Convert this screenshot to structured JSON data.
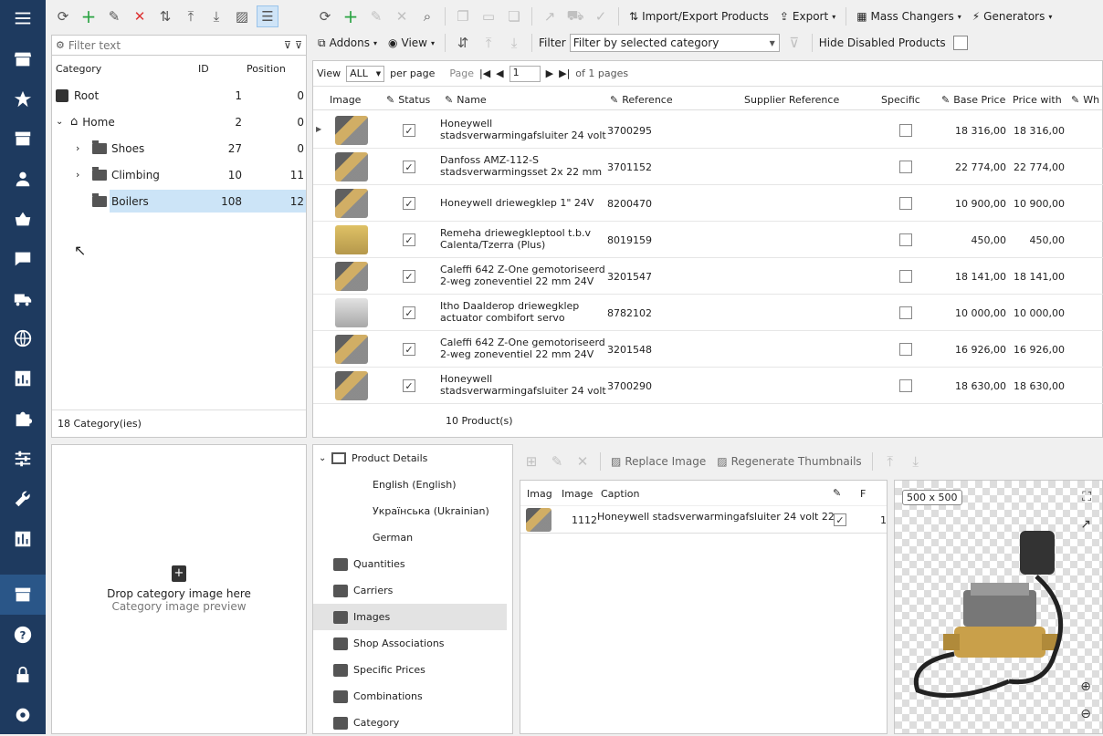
{
  "nav": {
    "items": [
      "menu-icon",
      "store-icon",
      "star-icon",
      "box-icon",
      "user-icon",
      "basket-icon",
      "chat-icon",
      "truck-icon",
      "globe-icon",
      "stats-icon",
      "puzzle-icon",
      "sliders-icon",
      "wrench-icon",
      "report-icon",
      "catalog-icon",
      "help-icon",
      "lock-icon",
      "settings-icon"
    ]
  },
  "cat_panel": {
    "filter_placeholder": "Filter text",
    "columns": {
      "category": "Category",
      "id": "ID",
      "position": "Position"
    },
    "rows": [
      {
        "name": "Root",
        "id": "1",
        "pos": "0"
      },
      {
        "name": "Home",
        "id": "2",
        "pos": "0"
      },
      {
        "name": "Shoes",
        "id": "27",
        "pos": "0"
      },
      {
        "name": "Climbing",
        "id": "10",
        "pos": "11"
      },
      {
        "name": "Boilers",
        "id": "108",
        "pos": "12"
      }
    ],
    "footer": "18 Category(ies)"
  },
  "drop_area": {
    "title": "Drop category image here",
    "subtitle": "Category image preview"
  },
  "products": {
    "toolbar": {
      "import_export": "Import/Export Products",
      "export": "Export",
      "mass_changers": "Mass Changers",
      "generators": "Generators",
      "addons": "Addons",
      "view": "View",
      "filter_label": "Filter",
      "filter_value": "Filter by selected category",
      "hide_disabled": "Hide Disabled Products"
    },
    "pager": {
      "view": "View",
      "view_value": "ALL",
      "per_page": "per page",
      "page": "Page",
      "page_value": "1",
      "of_pages": "of 1 pages"
    },
    "columns": {
      "image": "Image",
      "status": "Status",
      "name": "Name",
      "reference": "Reference",
      "supplier_ref": "Supplier Reference",
      "specific": "Specific",
      "base_price": "Base Price",
      "price_with": "Price with",
      "wh": "Wh"
    },
    "rows": [
      {
        "name1": "Honeywell",
        "name2": "stadsverwarmingafsluiter 24 volt",
        "ref": "3700295",
        "base": "18 316,00",
        "with": "18 316,00"
      },
      {
        "name1": "Danfoss AMZ-112-S",
        "name2": "stadsverwarmingsset 2x 22 mm",
        "ref": "3701152",
        "base": "22 774,00",
        "with": "22 774,00"
      },
      {
        "name1": "Honeywell driewegklep 1\" 24V",
        "name2": "",
        "ref": "8200470",
        "base": "10 900,00",
        "with": "10 900,00"
      },
      {
        "name1": "Remeha driewegkleptool t.b.v",
        "name2": "Calenta/Tzerra (Plus)",
        "ref": "8019159",
        "base": "450,00",
        "with": "450,00"
      },
      {
        "name1": "Caleffi 642 Z-One gemotoriseerd",
        "name2": "2-weg zoneventiel 22 mm 24V",
        "ref": "3201547",
        "base": "18 141,00",
        "with": "18 141,00"
      },
      {
        "name1": "Itho Daalderop driewegklep",
        "name2": "actuator combifort servo",
        "ref": "8782102",
        "base": "10 000,00",
        "with": "10 000,00"
      },
      {
        "name1": "Caleffi 642 Z-One gemotoriseerd",
        "name2": "2-weg zoneventiel 22 mm 24V",
        "ref": "3201548",
        "base": "16 926,00",
        "with": "16 926,00"
      },
      {
        "name1": "Honeywell",
        "name2": "stadsverwarmingafsluiter 24 volt",
        "ref": "3700290",
        "base": "18 630,00",
        "with": "18 630,00"
      }
    ],
    "footer": "10 Product(s)"
  },
  "details": {
    "items": [
      {
        "label": "Product Details",
        "indent": 0
      },
      {
        "label": "English (English)",
        "indent": 1
      },
      {
        "label": "Українська (Ukrainian)",
        "indent": 1
      },
      {
        "label": "German",
        "indent": 1
      },
      {
        "label": "Quantities",
        "indent": 0
      },
      {
        "label": "Carriers",
        "indent": 0
      },
      {
        "label": "Images",
        "indent": 0
      },
      {
        "label": "Shop Associations",
        "indent": 0
      },
      {
        "label": "Specific Prices",
        "indent": 0
      },
      {
        "label": "Combinations",
        "indent": 0
      },
      {
        "label": "Category",
        "indent": 0
      }
    ]
  },
  "images": {
    "toolbar": {
      "replace": "Replace Image",
      "regenerate": "Regenerate Thumbnails"
    },
    "columns": {
      "imag": "Imag",
      "image": "Image",
      "caption": "Caption",
      "f": "F"
    },
    "row": {
      "id": "1112",
      "caption": "Honeywell stadsverwarmingafsluiter 24 volt 22",
      "pos": "1"
    },
    "preview_size": "500 x 500"
  }
}
